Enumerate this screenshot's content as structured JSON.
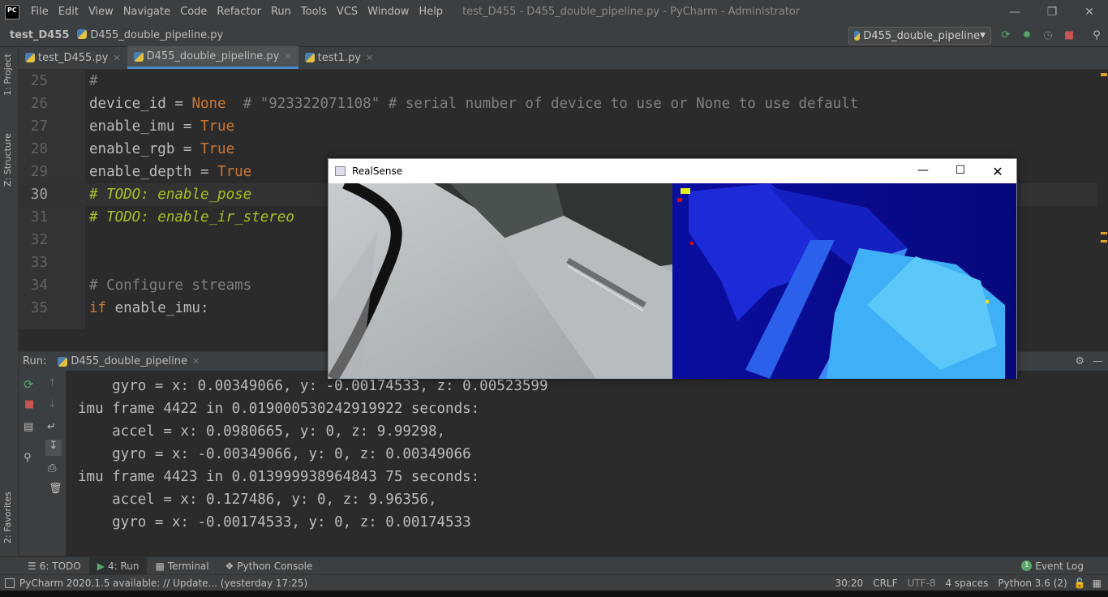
{
  "app": {
    "logo": "PC",
    "window_title": "test_D455 - D455_double_pipeline.py - PyCharm - Administrator"
  },
  "menu": [
    "File",
    "Edit",
    "View",
    "Navigate",
    "Code",
    "Refactor",
    "Run",
    "Tools",
    "VCS",
    "Window",
    "Help"
  ],
  "nav": {
    "project": "test_D455",
    "file": "D455_double_pipeline.py",
    "run_config": "D455_double_pipeline"
  },
  "left_tabs": {
    "project": "1: Project",
    "structure": "Z: Structure",
    "favorites": "2: Favorites"
  },
  "tabs": [
    {
      "label": "test_D455.py"
    },
    {
      "label": "D455_double_pipeline.py"
    },
    {
      "label": "test1.py"
    }
  ],
  "editor": {
    "lines": [
      {
        "num": "25",
        "text": "#"
      },
      {
        "num": "26"
      },
      {
        "num": "27"
      },
      {
        "num": "28"
      },
      {
        "num": "29"
      },
      {
        "num": "30",
        "text": "# TODO: enable_pose"
      },
      {
        "num": "31",
        "text": "# TODO: enable_ir_stereo"
      },
      {
        "num": "32",
        "text": ""
      },
      {
        "num": "33",
        "text": ""
      },
      {
        "num": "34",
        "text": "# Configure streams"
      },
      {
        "num": "35"
      }
    ],
    "code": {
      "l26_a": "device_id = ",
      "l26_kw": "None",
      "l26_cm": "  # \"923322071108\" # serial number of device to use or None to use default",
      "l27_a": "enable_imu = ",
      "l27_kw": "True",
      "l28_a": "enable_rgb = ",
      "l28_kw": "True",
      "l29_a": "enable_depth = ",
      "l29_kw": "True",
      "l35_kw": "if",
      "l35_a": " enable_imu:"
    }
  },
  "run": {
    "label": "Run:",
    "config": "D455_double_pipeline"
  },
  "console": [
    "    gyro = x: 0.00349066, y: -0.00174533, z: 0.00523599",
    "imu frame 4422 in 0.019000530242919922 seconds:",
    "    accel = x: 0.0980665, y: 0, z: 9.99298,",
    "    gyro = x: -0.00349066, y: 0, z: 0.00349066",
    "imu frame 4423 in 0.013999938964843 75 seconds:",
    "    accel = x: 0.127486, y: 0, z: 9.96356,",
    "    gyro = x: -0.00174533, y: 0, z: 0.00174533"
  ],
  "bottom_tabs": [
    {
      "label": "6: TODO"
    },
    {
      "label": "4: Run"
    },
    {
      "label": "Terminal"
    },
    {
      "label": "Python Console"
    }
  ],
  "event_log": {
    "count": "1",
    "label": "Event Log"
  },
  "status": {
    "message": "PyCharm 2020.1.5 available: // Update... (yesterday 17:25)",
    "position": "30:20",
    "line_sep": "CRLF",
    "encoding": "UTF-8",
    "indent": "4 spaces",
    "interpreter": "Python 3.6 (2)"
  },
  "realsense": {
    "title": "RealSense"
  },
  "colors": {
    "keyword": "#cc7832",
    "comment": "#808080",
    "todo": "#a8c023",
    "accent": "#4a88c7"
  }
}
